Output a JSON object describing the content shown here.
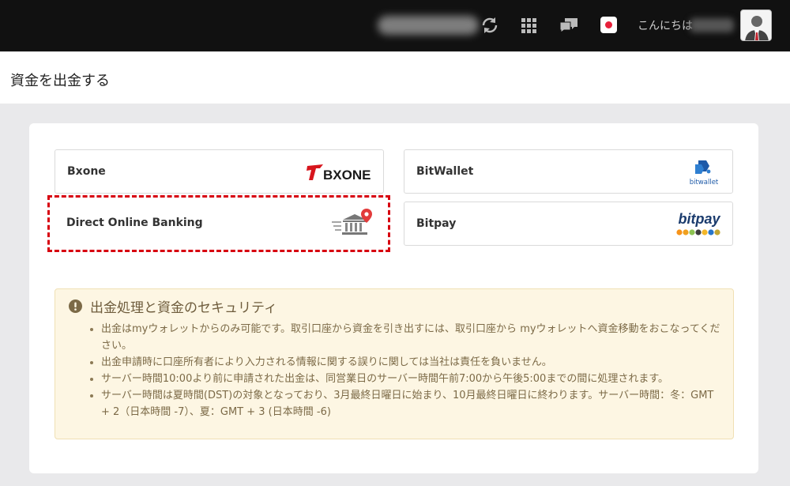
{
  "header": {
    "greeting": "こんにちは",
    "icons": [
      "refresh-icon",
      "apps-grid-icon",
      "chat-icon",
      "japan-flag-icon",
      "user-avatar-icon"
    ],
    "flag_color": "#e8213b"
  },
  "page": {
    "title": "資金を出金する"
  },
  "methods": [
    {
      "label": "Bxone",
      "logo_text": "BXONE"
    },
    {
      "label": "BitWallet",
      "logo_text": "bitwallet"
    },
    {
      "label": "Direct Online Banking",
      "selected": true
    },
    {
      "label": "Bitpay",
      "logo_text": "bitpay"
    }
  ],
  "security": {
    "title": "出金処理と資金のセキュリティ",
    "items": [
      "出金はmyウォレットからのみ可能です。取引口座から資金を引き出すには、取引口座から myウォレットへ資金移動をおこなってください。",
      "出金申請時に口座所有者により入力される情報に関する誤りに関しては当社は責任を負いません。",
      "サーバー時間10:00より前に申請された出金は、同営業日のサーバー時間午前7:00から午後5:00までの間に処理されます。",
      "サーバー時間は夏時間(DST)の対象となっており、3月最終日曜日に始まり、10月最終日曜日に終わります。サーバー時間：冬：GMT + 2（日本時間 -7）、夏：GMT + 3 (日本時間 -6)"
    ]
  },
  "colors": {
    "accent_red": "#d7000f",
    "notice_bg": "#fdf6e3",
    "topbar": "#111111"
  }
}
